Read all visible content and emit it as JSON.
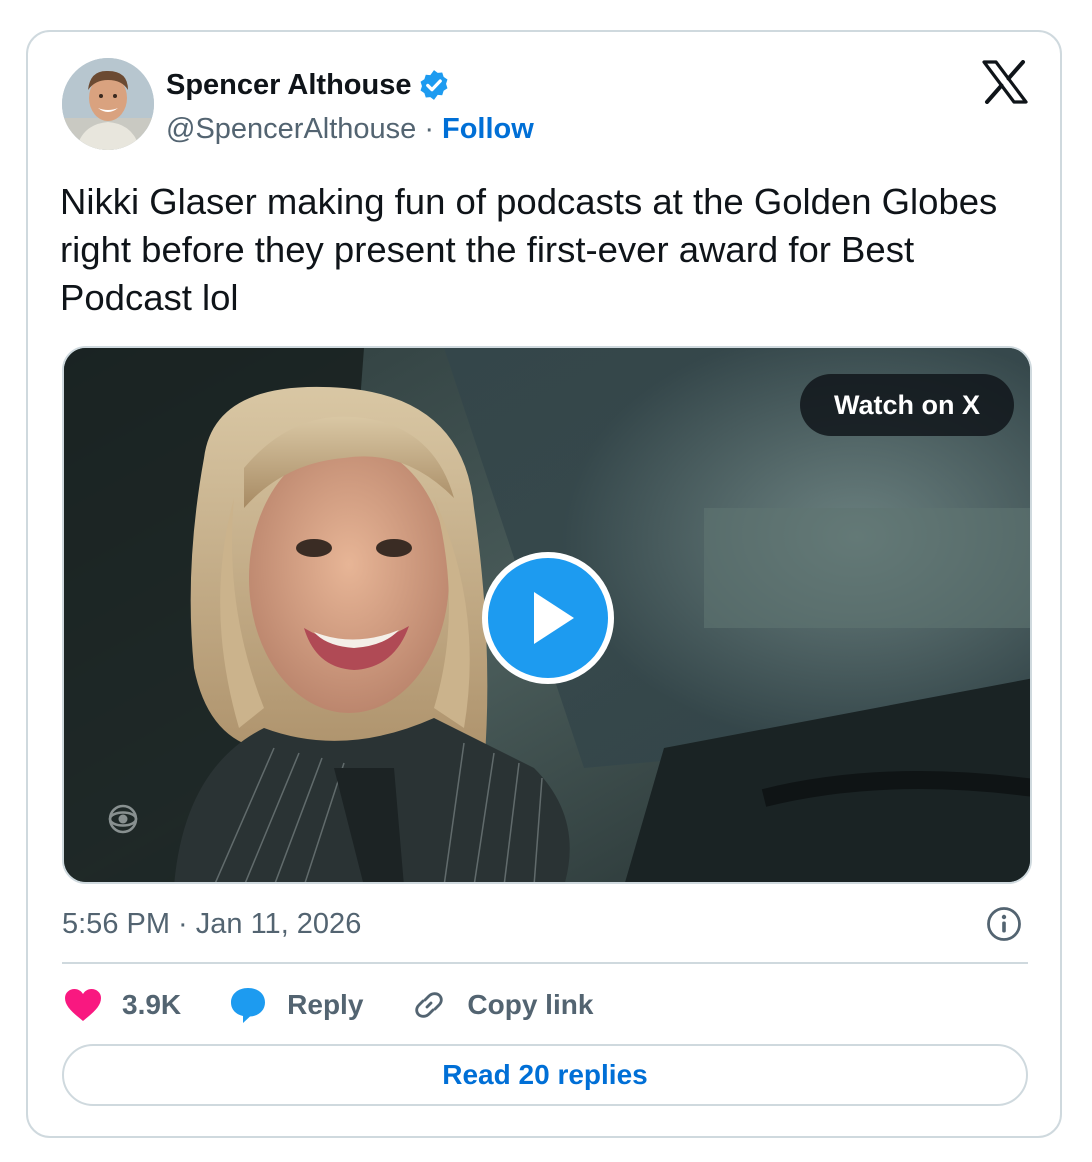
{
  "author": {
    "name": "Spencer Althouse",
    "handle": "@SpencerAlthouse",
    "separator": "·",
    "follow_label": "Follow",
    "verified": true
  },
  "tweet": {
    "text": "Nikki Glaser making fun of podcasts at the Golden Globes right before they present the first-ever award for Best Podcast lol"
  },
  "media": {
    "type": "video",
    "watch_label": "Watch on X"
  },
  "timestamp": "5:56 PM · Jan 11, 2026",
  "actions": {
    "likes": "3.9K",
    "reply_label": "Reply",
    "copy_label": "Copy link"
  },
  "read_replies_label": "Read 20 replies",
  "colors": {
    "accent": "#1d9bf0",
    "link": "#006fd6",
    "like": "#f91880",
    "secondary_text": "#536471",
    "border": "#cfd9de"
  },
  "icons": [
    "verified-badge-icon",
    "x-logo-icon",
    "play-icon",
    "info-icon",
    "heart-icon",
    "reply-bubble-icon",
    "link-icon"
  ]
}
